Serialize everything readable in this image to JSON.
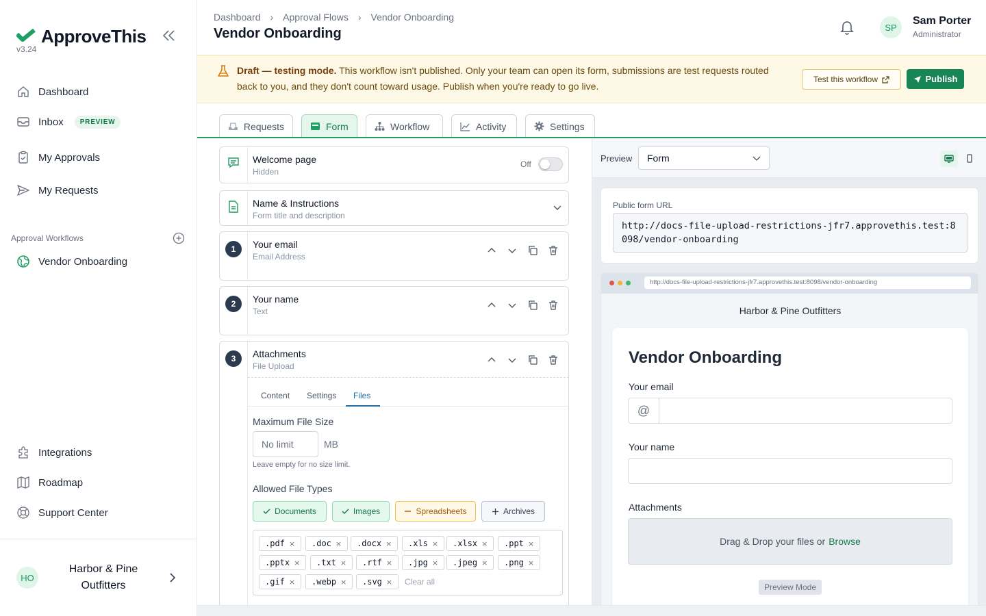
{
  "app": {
    "name": "ApproveThis",
    "version": "v3.24",
    "brand_color": "#1f9d62"
  },
  "sidebar": {
    "nav": [
      {
        "label": "Dashboard",
        "icon": "home-icon"
      },
      {
        "label": "Inbox",
        "icon": "inbox-icon",
        "badge": "PREVIEW"
      },
      {
        "label": "My Approvals",
        "icon": "clipboard-check-icon"
      },
      {
        "label": "My Requests",
        "icon": "send-icon"
      }
    ],
    "section_label": "Approval Workflows",
    "workflows": [
      {
        "label": "Vendor Onboarding",
        "icon": "globe-icon"
      }
    ],
    "bottom": [
      {
        "label": "Integrations",
        "icon": "puzzle-icon"
      },
      {
        "label": "Roadmap",
        "icon": "map-icon"
      },
      {
        "label": "Support Center",
        "icon": "lifebuoy-icon"
      }
    ],
    "org": {
      "initials": "HO",
      "name": "Harbor & Pine Outfitters"
    }
  },
  "header": {
    "breadcrumb": [
      "Dashboard",
      "Approval Flows",
      "Vendor Onboarding"
    ],
    "separator": "›",
    "title": "Vendor Onboarding",
    "user": {
      "initials": "SP",
      "name": "Sam Porter",
      "role": "Administrator"
    }
  },
  "banner": {
    "strong": "Draft — testing mode.",
    "text": " This workflow isn't published. Only your team can open its form, submissions are test requests routed back to you, and they don't count toward usage. Publish when you're ready to go live.",
    "test_button": "Test this workflow",
    "publish_button": "Publish"
  },
  "tabs": [
    {
      "label": "Requests",
      "active": false
    },
    {
      "label": "Form",
      "active": true
    },
    {
      "label": "Workflow",
      "active": false
    },
    {
      "label": "Activity",
      "active": false
    },
    {
      "label": "Settings",
      "active": false
    }
  ],
  "builder": {
    "welcome": {
      "title": "Welcome page",
      "subtitle": "Hidden",
      "toggle_label": "Off"
    },
    "name_instructions": {
      "title": "Name & Instructions",
      "subtitle": "Form title and description"
    },
    "fields": [
      {
        "number": "1",
        "title": "Your email",
        "subtitle": "Email Address"
      },
      {
        "number": "2",
        "title": "Your name",
        "subtitle": "Text"
      },
      {
        "number": "3",
        "title": "Attachments",
        "subtitle": "File Upload"
      }
    ],
    "subtabs": [
      "Content",
      "Settings",
      "Files"
    ],
    "active_subtab": "Files",
    "max_size_label": "Maximum File Size",
    "max_size_placeholder": "No limit",
    "max_size_unit": "MB",
    "max_size_hint": "Leave empty for no size limit.",
    "types_label": "Allowed File Types",
    "type_chips": [
      {
        "label": "Documents",
        "state": "checked"
      },
      {
        "label": "Images",
        "state": "checked"
      },
      {
        "label": "Spreadsheets",
        "state": "partial"
      },
      {
        "label": "Archives",
        "state": "none"
      }
    ],
    "extensions": [
      ".pdf",
      ".doc",
      ".docx",
      ".xls",
      ".xlsx",
      ".ppt",
      ".pptx",
      ".txt",
      ".rtf",
      ".jpg",
      ".jpeg",
      ".png",
      ".gif",
      ".webp",
      ".svg"
    ],
    "remove_glyph": "×",
    "clear_all": "Clear all"
  },
  "preview": {
    "label": "Preview",
    "select_value": "Form",
    "url_label": "Public form URL",
    "url": "http://docs-file-upload-restrictions-jfr7.approvethis.test:8098/vendor-onboarding",
    "company": "Harbor & Pine Outfitters",
    "form_title": "Vendor Onboarding",
    "email_label": "Your email",
    "email_prefix": "@",
    "name_label": "Your name",
    "attachments_label": "Attachments",
    "drop_text": "Drag & Drop your files or",
    "browse": "Browse",
    "preview_mode": "Preview Mode"
  }
}
